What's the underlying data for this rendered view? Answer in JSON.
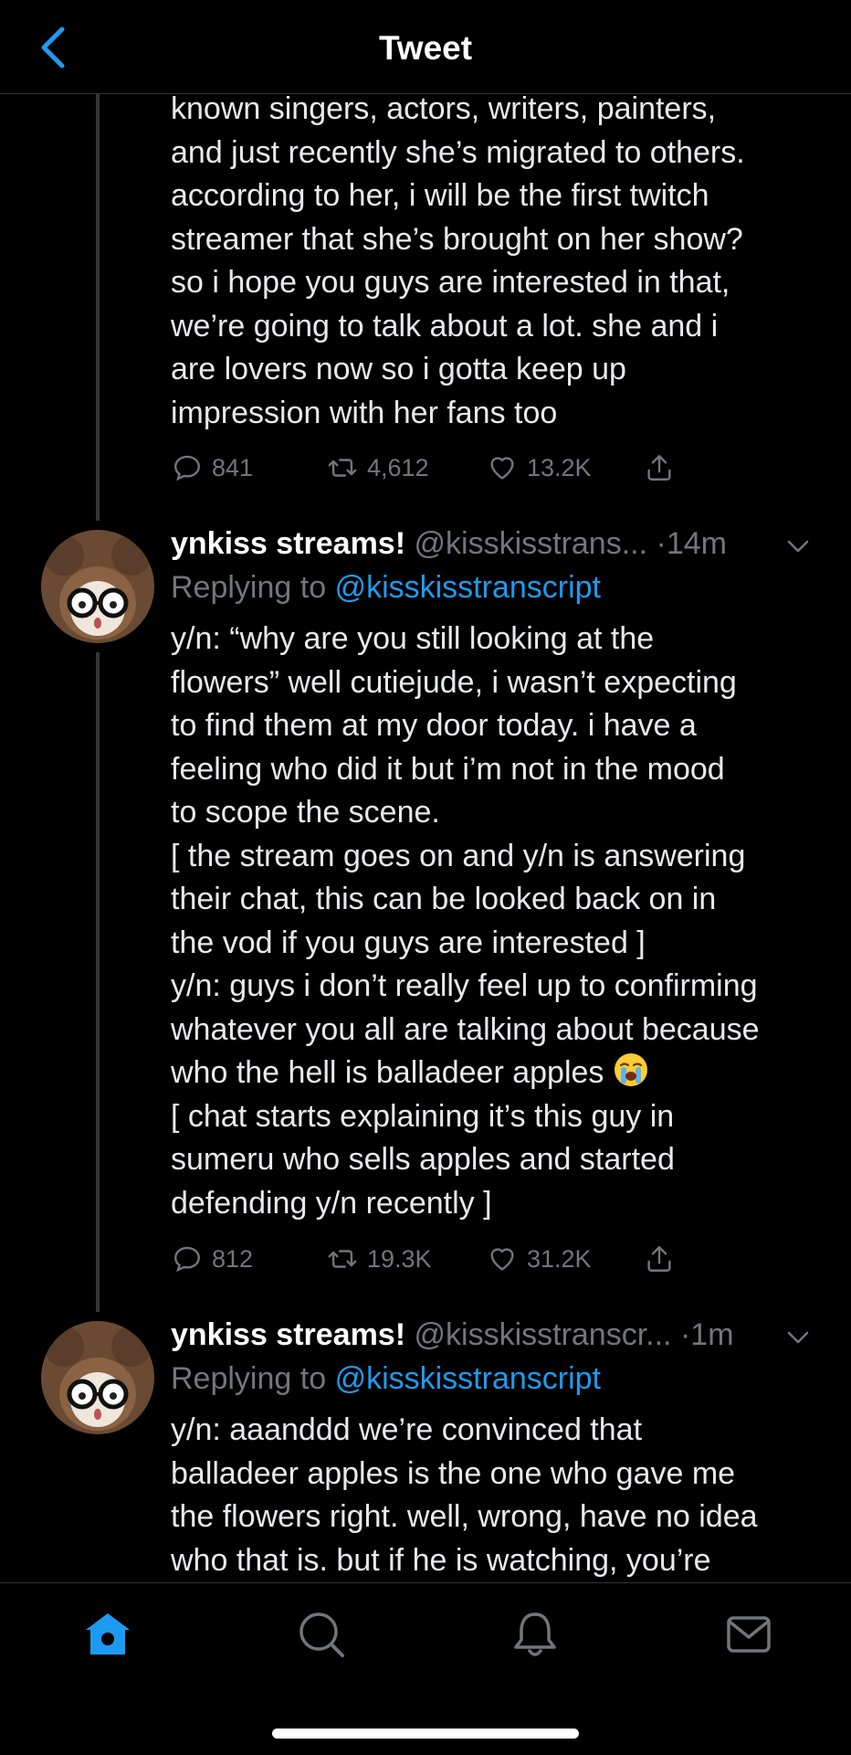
{
  "header": {
    "title": "Tweet",
    "back_icon": "chevron-left-icon"
  },
  "tweets": [
    {
      "text": "known singers, actors, writers, painters,\nand just recently she’s migrated to others.\naccording to her, i will be the first twitch\nstreamer that she’s brought on her show?\nso i hope you guys are interested in that,\nwe’re going to talk about a lot. she and i\nare lovers now so i gotta keep up\nimpression with her fans too",
      "replies": "841",
      "retweets": "4,612",
      "likes": "13.2K"
    },
    {
      "name": "ynkiss streams!",
      "handle": "@kisskisstrans...",
      "separator": "·",
      "time": "14m",
      "replying_prefix": "Replying to",
      "replying_to": "@kisskisstranscript",
      "text_before_emoji": "y/n: “why are you still looking at the\nflowers” well cutiejude, i wasn’t expecting\nto find them at my door today. i have a\nfeeling who did it but i’m not in the mood\nto scope the scene.\n[ the stream goes on and y/n is answering\ntheir chat, this can be looked back on in\nthe vod if you guys are interested ]\ny/n: guys i don’t really feel up to confirming\nwhatever you all are talking about because\nwho the hell is balladeer apples ",
      "emoji": "loudly-crying-face",
      "text_after_emoji": "\n[ chat starts explaining it’s this guy in\nsumeru who sells apples and started\ndefending y/n recently ]",
      "replies": "812",
      "retweets": "19.3K",
      "likes": "31.2K"
    },
    {
      "name": "ynkiss streams!",
      "handle": "@kisskisstranscr...",
      "separator": "·",
      "time": "1m",
      "replying_prefix": "Replying to",
      "replying_to": "@kisskisstranscript",
      "text": "y/n: aaanddd we’re convinced that\nballadeer apples is the one who gave me\nthe flowers right. well, wrong, have no idea\nwho that is. but if he is watching, you’re"
    }
  ],
  "tabbar": {
    "tabs": [
      "home-icon",
      "search-icon",
      "notifications-icon",
      "messages-icon"
    ]
  },
  "colors": {
    "accent": "#1d9bf0",
    "muted": "#71767b",
    "text": "#e7e9ea",
    "background": "#000000"
  }
}
